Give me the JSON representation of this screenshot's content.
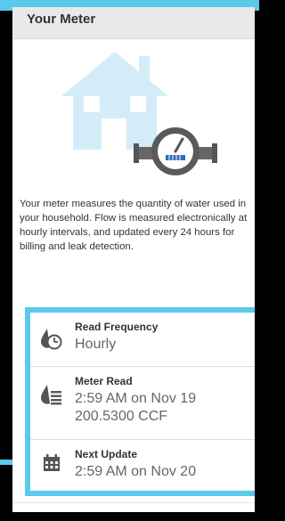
{
  "header": {
    "title": "Your Meter"
  },
  "illustration": {
    "house_icon": "house-icon",
    "meter_icon": "water-meter-icon",
    "colors": {
      "house": "#cfe9f6",
      "meter_body": "#5a5a5a",
      "dial": "#2e6fb7"
    }
  },
  "description": "Your meter measures the quantity of water used in your household. Flow is measured electronically at hourly intervals, and updated every 24 hours for billing and leak detection.",
  "details": {
    "read_frequency": {
      "icon": "water-drop-clock-icon",
      "label": "Read Frequency",
      "value": "Hourly"
    },
    "meter_read": {
      "icon": "water-drop-list-icon",
      "label": "Meter Read",
      "time": "2:59 AM on Nov 19",
      "reading": "200.5300 CCF"
    },
    "next_update": {
      "icon": "calendar-icon",
      "label": "Next Update",
      "value": "2:59 AM on Nov 20"
    }
  },
  "accent_color": "#5cc8ec"
}
